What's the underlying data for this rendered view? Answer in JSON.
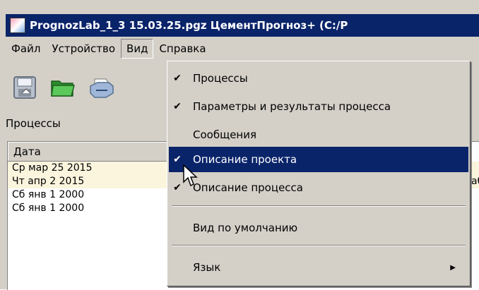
{
  "window": {
    "title": "PrognozLab_1_3 15.03.25.pgz  ЦементПрогноз+  (C:/P"
  },
  "menubar": {
    "items": [
      "Файл",
      "Устройство",
      "Вид",
      "Справка"
    ]
  },
  "panel": {
    "label": "Процессы"
  },
  "list": {
    "column_header": "Дата",
    "rows": [
      "Ср мар 25 2015",
      "Чт апр 2 2015",
      "Сб янв 1 2000",
      "Сб янв 1 2000"
    ],
    "side_text": "аб"
  },
  "view_menu": {
    "items": [
      {
        "label": "Процессы",
        "checked": "✔"
      },
      {
        "label": "Параметры и результаты процесса",
        "checked": "✔"
      },
      {
        "label": "Сообщения",
        "checked": ""
      },
      {
        "label": "Описание проекта",
        "checked": "✔"
      },
      {
        "label": "Описание процесса",
        "checked": "✔"
      }
    ],
    "default_view": "Вид по умолчанию",
    "language": "Язык"
  },
  "colors": {
    "titlebar": "#0a246a",
    "selection": "#0a246a",
    "window_bg": "#d4d0c8"
  }
}
